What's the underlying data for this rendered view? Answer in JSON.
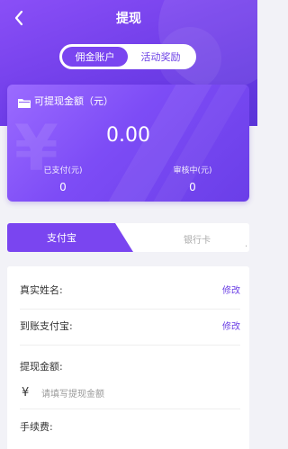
{
  "nav": {
    "title": "提现"
  },
  "segment": {
    "tabs": [
      "佣金账户",
      "活动奖励"
    ],
    "active_index": 0
  },
  "balance_card": {
    "label": "可提现金额（元）",
    "amount": "0.00",
    "paid_label": "已支付(元)",
    "paid_value": "0",
    "reviewing_label": "审核中(元)",
    "reviewing_value": "0"
  },
  "method_tabs": {
    "active": "支付宝",
    "inactive": "银行卡",
    "trailing": "."
  },
  "form": {
    "real_name_label": "真实姓名:",
    "real_name_edit": "修改",
    "alipay_label": "到账支付宝:",
    "alipay_edit": "修改",
    "withdraw_amount_label": "提现金额:",
    "currency_symbol": "¥",
    "amount_placeholder": "请填写提现金额",
    "fee_label": "手续费:"
  },
  "colors": {
    "accent": "#7a45f0",
    "header_start": "#8a4ff7",
    "header_end": "#5a35d9"
  }
}
